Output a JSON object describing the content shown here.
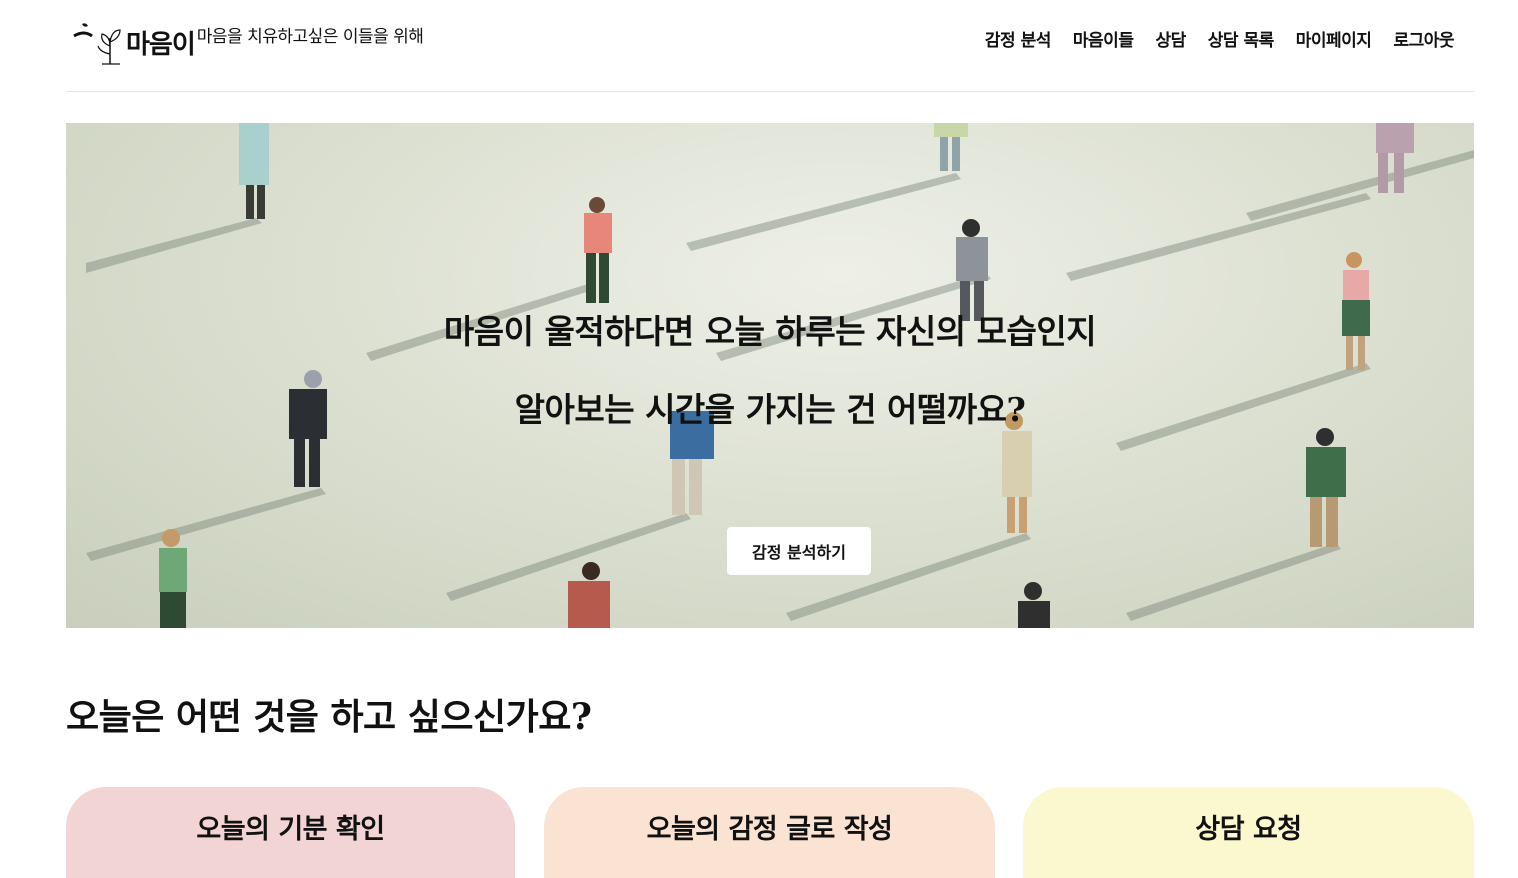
{
  "header": {
    "logo_name": "마음이",
    "tagline": "마음을 치유하고싶은 이들을 위해",
    "nav": [
      {
        "label": "감정 분석"
      },
      {
        "label": "마음이들"
      },
      {
        "label": "상담"
      },
      {
        "label": "상담 목록"
      },
      {
        "label": "마이페이지"
      },
      {
        "label": "로그아웃"
      }
    ]
  },
  "hero": {
    "line1": "마음이 울적하다면 오늘 하루는 자신의 모습인지",
    "line2": "알아보는 시간을 가지는 건 어떨까요?",
    "button_label": "감정 분석하기"
  },
  "section": {
    "title": "오늘은 어떤 것을 하고 싶으신가요?"
  },
  "cards": [
    {
      "label": "오늘의 기분 확인",
      "color": "#f2d4d4"
    },
    {
      "label": "오늘의 감정 글로 작성",
      "color": "#fbe3d3"
    },
    {
      "label": "상담 요청",
      "color": "#fbf8cf"
    }
  ]
}
